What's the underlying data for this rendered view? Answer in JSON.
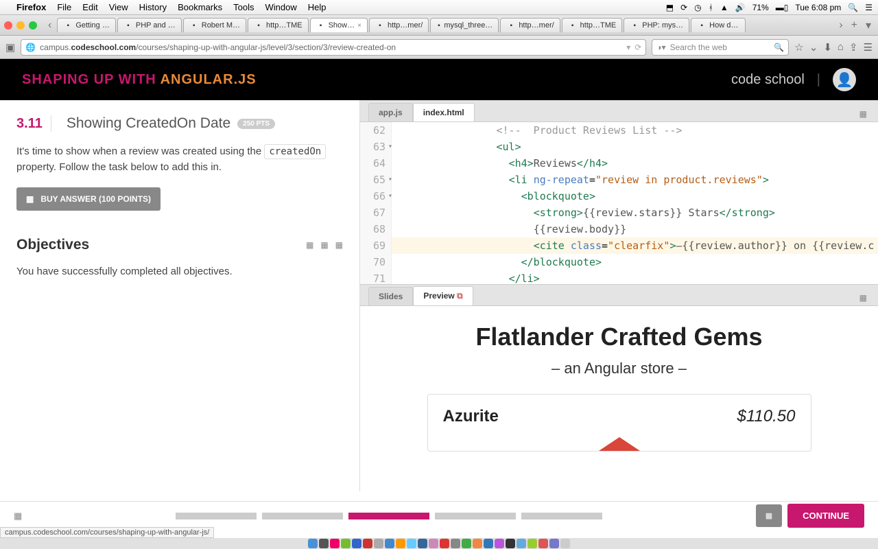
{
  "menubar": {
    "app": "Firefox",
    "items": [
      "File",
      "Edit",
      "View",
      "History",
      "Bookmarks",
      "Tools",
      "Window",
      "Help"
    ],
    "battery": "71%",
    "clock": "Tue 6:08 pm"
  },
  "tabs": [
    {
      "label": "Getting …",
      "active": false
    },
    {
      "label": "PHP and …",
      "active": false
    },
    {
      "label": "Robert M…",
      "active": false
    },
    {
      "label": "http…TME",
      "active": false
    },
    {
      "label": "Show…",
      "active": true
    },
    {
      "label": "http…mer/",
      "active": false
    },
    {
      "label": "mysql_three…",
      "active": false
    },
    {
      "label": "http…mer/",
      "active": false
    },
    {
      "label": "http…TME",
      "active": false
    },
    {
      "label": "PHP: mys…",
      "active": false
    },
    {
      "label": "How d…",
      "active": false
    }
  ],
  "address": {
    "url_prefix": "campus.",
    "url_bold": "codeschool.com",
    "url_rest": "/courses/shaping-up-with-angular-js/level/3/section/3/review-created-on",
    "search_placeholder": "Search the web"
  },
  "header": {
    "brand1": "SHAPING UP WITH ",
    "brand2": "ANGULAR.JS",
    "right": "code school"
  },
  "lesson": {
    "num": "3.11",
    "title": "Showing CreatedOn Date",
    "pts": "250 PTS",
    "body_1": "It's time to show when a review was created using the ",
    "body_code": "createdOn",
    "body_2": " property. Follow the task below to add this in.",
    "buy": "BUY ANSWER (100 POINTS)",
    "objectives_h": "Objectives",
    "objectives_t": "You have successfully completed all objectives."
  },
  "code_tabs": {
    "a": "app.js",
    "b": "index.html"
  },
  "code_lines": [
    {
      "n": "62",
      "fold": "",
      "html": "                <span class='t-cmt'>&lt;!--  Product Reviews List --&gt;</span>"
    },
    {
      "n": "63",
      "fold": "▾",
      "html": "                <span class='t-tag'>&lt;ul&gt;</span>"
    },
    {
      "n": "64",
      "fold": "",
      "html": "                  <span class='t-tag'>&lt;h4&gt;</span><span class='t-txt'>Reviews</span><span class='t-tag'>&lt;/h4&gt;</span>"
    },
    {
      "n": "65",
      "fold": "▾",
      "html": "                  <span class='t-tag'>&lt;li</span> <span class='t-attr'>ng-repeat</span>=<span class='t-str'>\"review in product.reviews\"</span><span class='t-tag'>&gt;</span>"
    },
    {
      "n": "66",
      "fold": "▾",
      "html": "                    <span class='t-tag'>&lt;blockquote&gt;</span>"
    },
    {
      "n": "67",
      "fold": "",
      "html": "                      <span class='t-tag'>&lt;strong&gt;</span><span class='t-txt'>{{review.stars}} Stars</span><span class='t-tag'>&lt;/strong&gt;</span>"
    },
    {
      "n": "68",
      "fold": "",
      "html": "                      <span class='t-txt'>{{review.body}}</span>"
    },
    {
      "n": "69",
      "fold": "",
      "hl": true,
      "html": "                      <span class='t-tag'>&lt;cite</span> <span class='t-attr'>class</span>=<span class='t-str'>\"clearfix\"</span><span class='t-tag'>&gt;</span><span class='t-txt'>—{{review.author}} on {{review.c</span>"
    },
    {
      "n": "70",
      "fold": "",
      "html": "                    <span class='t-tag'>&lt;/blockquote&gt;</span>"
    },
    {
      "n": "71",
      "fold": "",
      "html": "                  <span class='t-tag'>&lt;/li&gt;</span>"
    }
  ],
  "preview_tabs": {
    "a": "Slides",
    "b": "Preview"
  },
  "preview": {
    "title": "Flatlander Crafted Gems",
    "sub": "– an Angular store –",
    "product": "Azurite",
    "price": "$110.50"
  },
  "footer": {
    "continue": "CONTINUE",
    "status_url": "campus.codeschool.com/courses/shaping-up-with-angular-js/"
  }
}
